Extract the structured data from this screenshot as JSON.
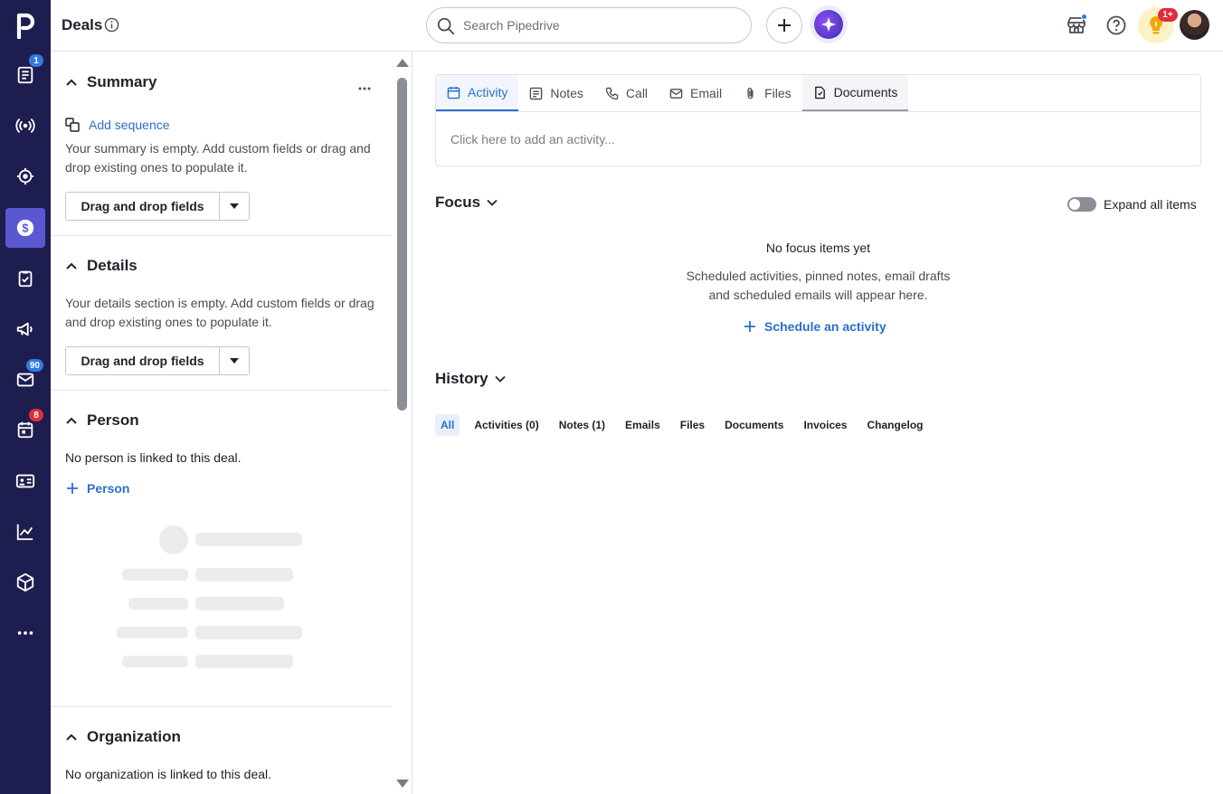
{
  "topbar": {
    "title": "Deals",
    "search_placeholder": "Search Pipedrive",
    "tips_badge": "1+"
  },
  "leftnav": {
    "items": [
      {
        "name": "leads-inbox",
        "icon": "list-icon",
        "badge": "1"
      },
      {
        "name": "radar",
        "icon": "broadcast-icon",
        "badge": ""
      },
      {
        "name": "projects",
        "icon": "target-icon",
        "badge": ""
      },
      {
        "name": "deals",
        "icon": "dollar-icon",
        "badge": "",
        "active": true
      },
      {
        "name": "activities",
        "icon": "clipboard-check-icon",
        "badge": ""
      },
      {
        "name": "campaigns",
        "icon": "megaphone-icon",
        "badge": ""
      },
      {
        "name": "mail",
        "icon": "envelope-icon",
        "badge": "90"
      },
      {
        "name": "calendar",
        "icon": "calendar-icon",
        "badge": "8"
      },
      {
        "name": "contacts",
        "icon": "contact-card-icon",
        "badge": ""
      },
      {
        "name": "insights",
        "icon": "chart-icon",
        "badge": ""
      },
      {
        "name": "products",
        "icon": "box-icon",
        "badge": ""
      },
      {
        "name": "more",
        "icon": "more-icon",
        "badge": ""
      }
    ]
  },
  "sidebar": {
    "summary": {
      "title": "Summary",
      "add_sequence": "Add sequence",
      "empty_text": "Your summary is empty. Add custom fields or drag and drop existing ones to populate it.",
      "button": "Drag and drop fields"
    },
    "details": {
      "title": "Details",
      "empty_text": "Your details section is empty. Add custom fields or drag and drop existing ones to populate it.",
      "button": "Drag and drop fields"
    },
    "person": {
      "title": "Person",
      "empty_text": "No person is linked to this deal.",
      "add_link": "Person"
    },
    "organization": {
      "title": "Organization",
      "empty_text": "No organization is linked to this deal."
    }
  },
  "composer": {
    "tabs": [
      "Activity",
      "Notes",
      "Call",
      "Email",
      "Files",
      "Documents"
    ],
    "active_tab": "Activity",
    "placeholder": "Click here to add an activity..."
  },
  "focus": {
    "title": "Focus",
    "toggle_label": "Expand all items",
    "empty_title": "No focus items yet",
    "empty_desc_line1": "Scheduled activities, pinned notes, email drafts",
    "empty_desc_line2": "and scheduled emails will appear here.",
    "schedule_link": "Schedule an activity"
  },
  "history": {
    "title": "History",
    "filters": [
      "All",
      "Activities (0)",
      "Notes (1)",
      "Emails",
      "Files",
      "Documents",
      "Invoices",
      "Changelog"
    ],
    "active_filter": "All"
  },
  "colors": {
    "nav_bg": "#1e1d4f",
    "nav_active": "#5b57d1",
    "link": "#2a6fc9"
  }
}
